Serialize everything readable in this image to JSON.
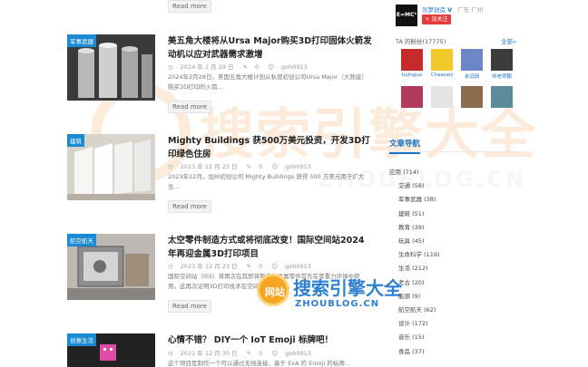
{
  "posts": [
    {
      "more_label": "Read more"
    },
    {
      "tag": "军事武器",
      "title": "美五角大楼将从Ursa Major购买3D打印固体火箭发动机以应对武器需求激增",
      "date": "2024 年 2 月 29 日",
      "comments": "0",
      "author": "goh0913",
      "excerpt": "2024年2月28日，美国五角大楼计划从私营初创公司Ursa Major（大熊座）购买3D打印的火箭...",
      "more_label": "Read more"
    },
    {
      "tag": "建筑",
      "title": "Mighty Buildings 获500万美元投资，开发3D打印绿色住房",
      "date": "2023 年 12 月 23 日",
      "comments": "0",
      "author": "goh0913",
      "excerpt": "2023年12月，加州初创公司 Mighty Buildings 获得 500 万美元用于扩大生...",
      "more_label": "Read more"
    },
    {
      "tag": "航空航天",
      "title": "太空零件制造方式或将彻底改变！国际空间站2024年再迎金属3D打印项目",
      "date": "2023 年 12 月 23 日",
      "comments": "0",
      "author": "goh0913",
      "excerpt": "国际空间站（ISS）将再次在其即将制造的金属零件首先在零重力环境中使用。这再次证明3D打印技术在空间探索...",
      "more_label": "Read more"
    },
    {
      "tag": "创意生活",
      "title": "心情不错？ DIY一个 IoT Emoji 标牌吧！",
      "date": "2022 年 12 月 30 日",
      "comments": "0",
      "author": "goh0913",
      "excerpt": "这个项目是制作一个可以通过无线连接、基于 ExA 的 Emoji 的标牌..."
    }
  ],
  "sidebar": {
    "profile": {
      "avatar_text": "E=MC²",
      "name": "氘梦创造",
      "verified": "V",
      "location": "广东 广州",
      "follow_label": "+ 加关注"
    },
    "fans": {
      "title": "TA 的粉丝(17775)",
      "all_label": "全部»",
      "items": [
        {
          "name": "tujinguo",
          "color": "#c62a2a"
        },
        {
          "name": "Chaasaiz",
          "color": "#f2c92a"
        },
        {
          "name": "未远田",
          "color": "#6d86c6"
        },
        {
          "name": "何老师鹏",
          "color": "#3c3c3c"
        },
        {
          "name": "",
          "color": "#b03b5c"
        },
        {
          "name": "",
          "color": "#e4e4e4"
        },
        {
          "name": "",
          "color": "#8c6c4c"
        },
        {
          "name": "",
          "color": "#5c8c9c"
        }
      ]
    },
    "nav_title": "文章导航",
    "categories": [
      "应用 (714)",
      "交通 (58)",
      "军事武器 (38)",
      "建筑 (51)",
      "教育 (39)",
      "玩具 (45)",
      "生命科学 (119)",
      "生活 (212)",
      "考古 (20)",
      "能源 (9)",
      "航空航天 (62)",
      "设计 (172)",
      "音乐 (15)",
      "食品 (37)"
    ]
  },
  "watermark": {
    "big_text": "搜索引擎大全",
    "big_url": "ZHOUBLOG.CN",
    "small_badge": "网站",
    "small_text": "搜索引擎大全",
    "small_url": "ZHOUBLOG.CN"
  }
}
